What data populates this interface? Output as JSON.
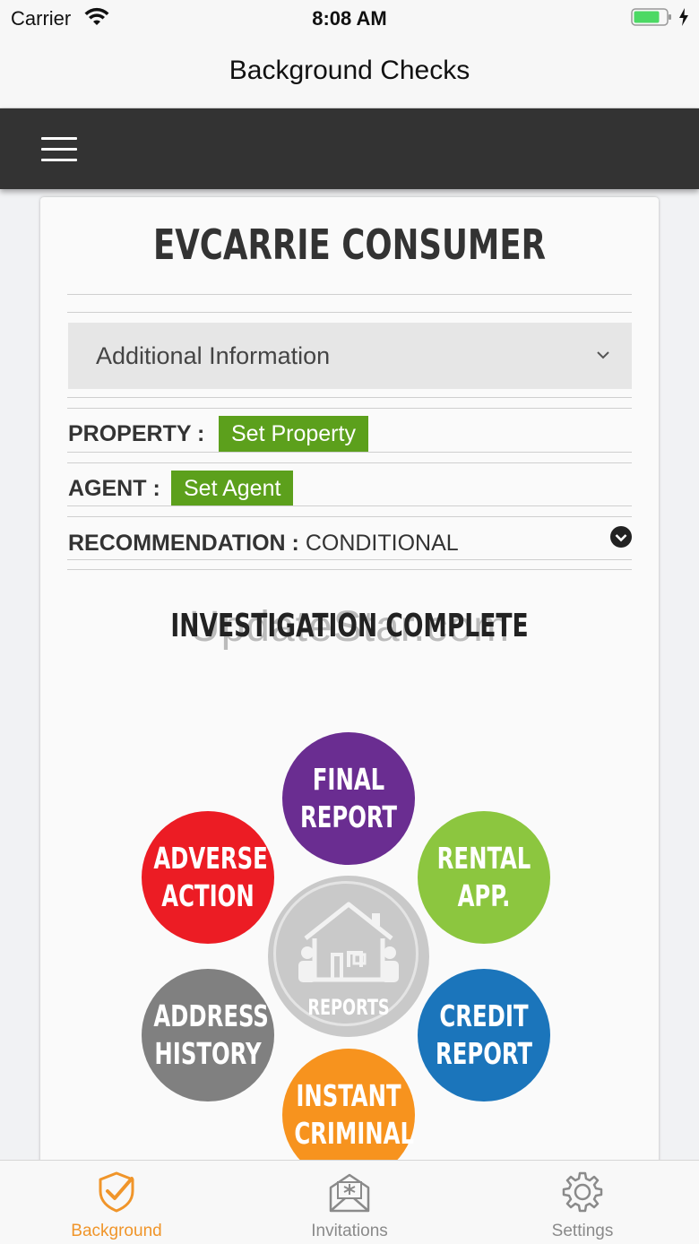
{
  "status_bar": {
    "carrier": "Carrier",
    "time": "8:08 AM"
  },
  "nav": {
    "title": "Background Checks"
  },
  "card": {
    "consumer_name": "EVCARRIE CONSUMER",
    "accordion_label": "Additional Information",
    "property_label": "PROPERTY :",
    "property_button": "Set Property",
    "agent_label": "AGENT :",
    "agent_button": "Set Agent",
    "recommendation_label": "RECOMMENDATION :",
    "recommendation_value": "CONDITIONAL",
    "status_heading": "INVESTIGATION COMPLETE",
    "watermark": "UpdateStar.com"
  },
  "reports": {
    "hub_label": "REPORTS",
    "final_report": {
      "line1": "FINAL",
      "line2": "REPORT",
      "color": "#6a2d91"
    },
    "rental_app": {
      "line1": "RENTAL",
      "line2": "APP.",
      "color": "#8cc63f"
    },
    "credit_report": {
      "line1": "CREDIT",
      "line2": "REPORT",
      "color": "#1b75bb"
    },
    "instant_criminal": {
      "line1": "INSTANT",
      "line2": "CRIMINAL",
      "color": "#f7931e"
    },
    "address_history": {
      "line1": "ADDRESS",
      "line2": "HISTORY",
      "color": "#808080"
    },
    "adverse_action": {
      "line1": "ADVERSE",
      "line2": "ACTION",
      "color": "#ec1c24"
    }
  },
  "tabs": [
    {
      "label": "Background",
      "icon": "shield-check-icon",
      "active": true
    },
    {
      "label": "Invitations",
      "icon": "envelope-icon",
      "active": false
    },
    {
      "label": "Settings",
      "icon": "gear-icon",
      "active": false
    }
  ],
  "colors": {
    "accent": "#f0952a",
    "toolbar": "#333333",
    "button_green": "#5ca01c"
  }
}
